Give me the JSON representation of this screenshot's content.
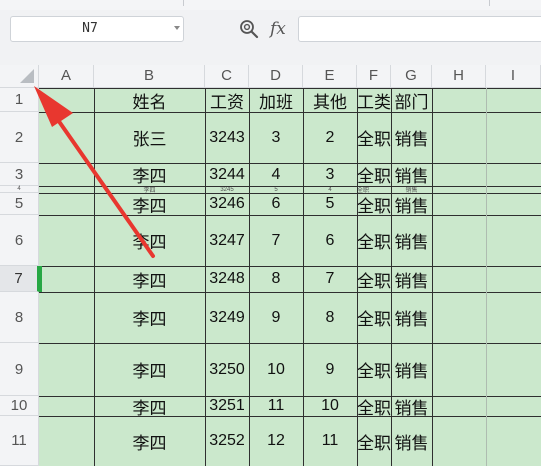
{
  "name_box": {
    "value": "N7"
  },
  "formula_bar": {
    "fx_label": "fx",
    "zoom_icon": "zoom-search-icon",
    "content": ""
  },
  "columns": [
    "A",
    "B",
    "C",
    "D",
    "E",
    "F",
    "G",
    "H",
    "I"
  ],
  "rows": [
    {
      "label": "1",
      "cells": [
        "",
        "姓名",
        "工资",
        "加班",
        "其他",
        "工类",
        "部门",
        "",
        ""
      ]
    },
    {
      "label": "2",
      "cells": [
        "",
        "张三",
        "3243",
        "3",
        "2",
        "全职",
        "销售",
        "",
        ""
      ]
    },
    {
      "label": "3",
      "cells": [
        "",
        "李四",
        "3244",
        "4",
        "3",
        "全职",
        "销售",
        "",
        ""
      ]
    },
    {
      "label": "4",
      "cells": [
        "",
        "李四",
        "3245",
        "5",
        "4",
        "全职",
        "销售",
        "",
        ""
      ]
    },
    {
      "label": "5",
      "cells": [
        "",
        "李四",
        "3246",
        "6",
        "5",
        "全职",
        "销售",
        "",
        ""
      ]
    },
    {
      "label": "6",
      "cells": [
        "",
        "李四",
        "3247",
        "7",
        "6",
        "全职",
        "销售",
        "",
        ""
      ]
    },
    {
      "label": "7",
      "cells": [
        "",
        "李四",
        "3248",
        "8",
        "7",
        "全职",
        "销售",
        "",
        ""
      ]
    },
    {
      "label": "8",
      "cells": [
        "",
        "李四",
        "3249",
        "9",
        "8",
        "全职",
        "销售",
        "",
        ""
      ]
    },
    {
      "label": "9",
      "cells": [
        "",
        "李四",
        "3250",
        "10",
        "9",
        "全职",
        "销售",
        "",
        ""
      ]
    },
    {
      "label": "10",
      "cells": [
        "",
        "李四",
        "3251",
        "11",
        "10",
        "全职",
        "销售",
        "",
        ""
      ]
    },
    {
      "label": "11",
      "cells": [
        "",
        "李四",
        "3252",
        "12",
        "11",
        "全职",
        "销售",
        "",
        ""
      ]
    }
  ],
  "selected_row": "7",
  "colors": {
    "fill": "#cbe8cc",
    "selection": "#27a744",
    "annotation_arrow": "#e8372f"
  }
}
